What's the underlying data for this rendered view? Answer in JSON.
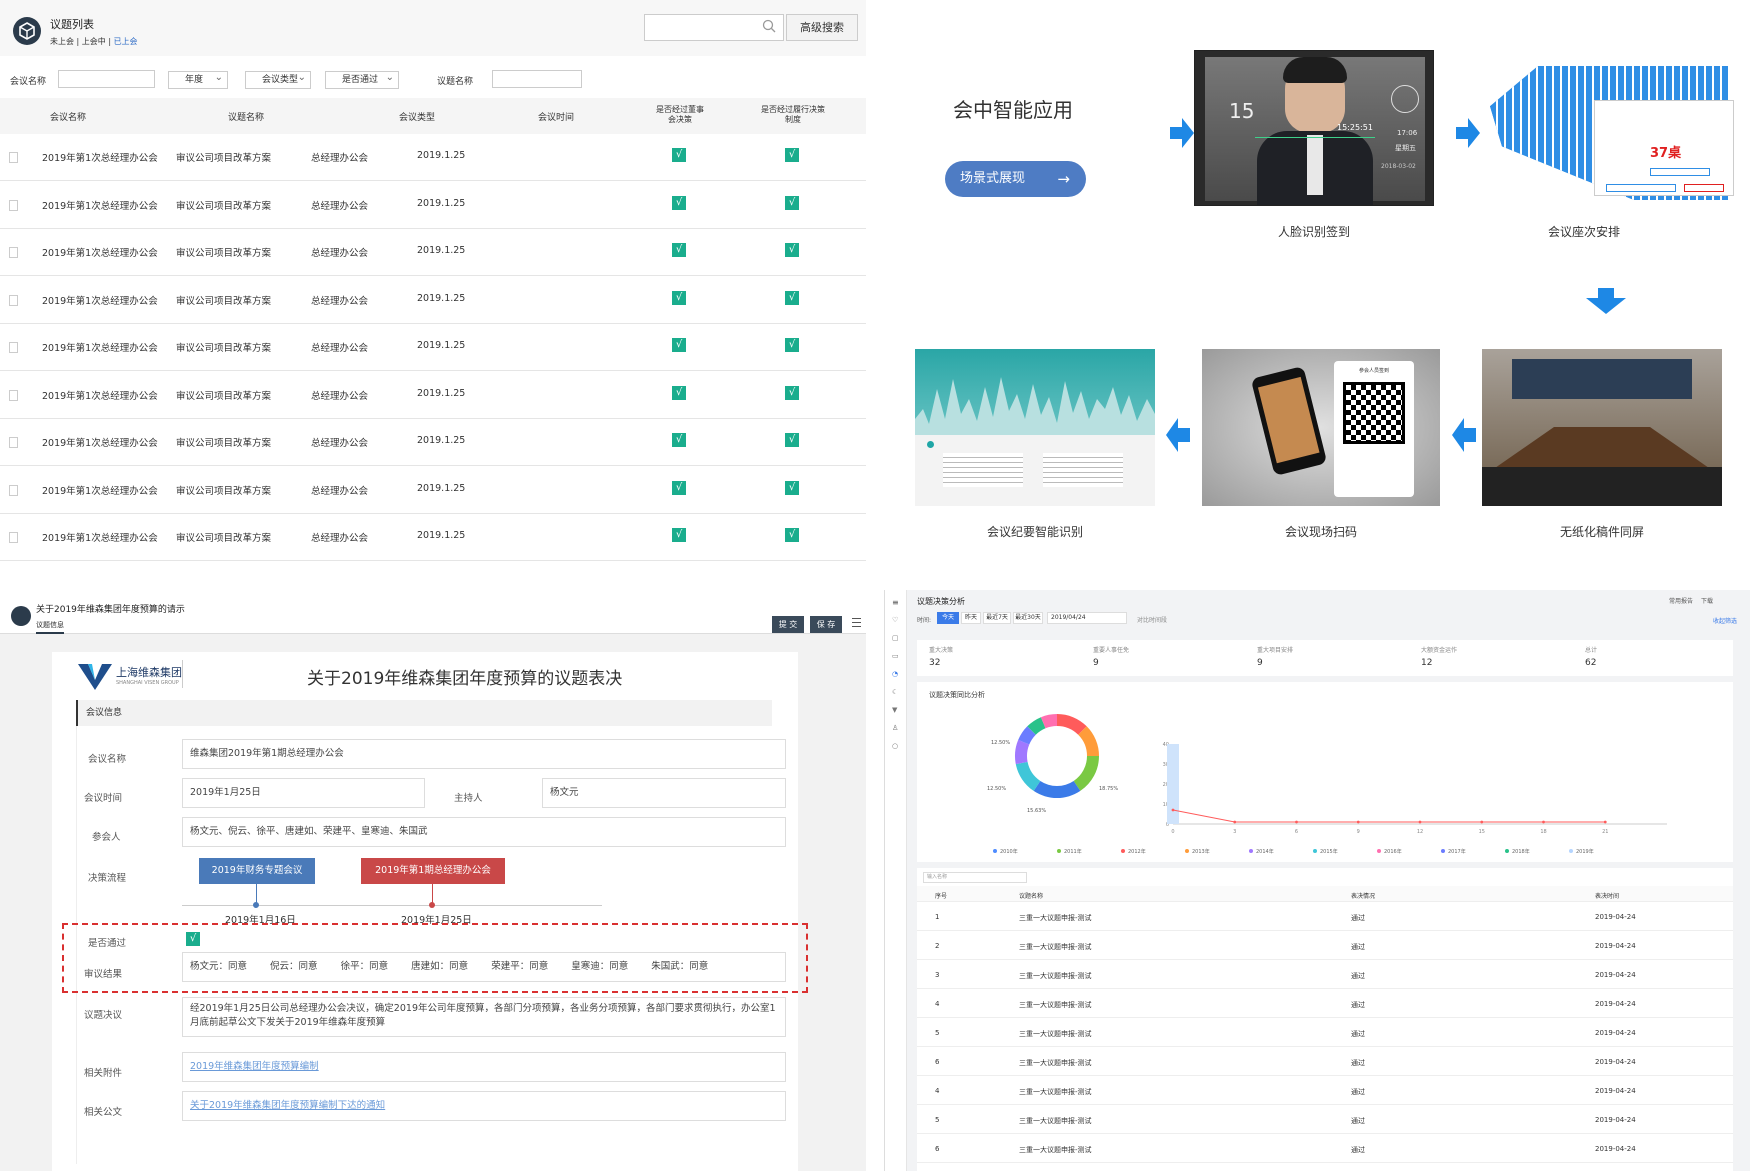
{
  "q1": {
    "title": "议题列表",
    "status_tabs": [
      "未上会",
      "上会中",
      "已上会"
    ],
    "search_button": "高级搜索",
    "filters": {
      "meeting_name_label": "会议名称",
      "year": "年度",
      "meeting_type": "会议类型",
      "passed": "是否通过",
      "topic_name_label": "议题名称"
    },
    "columns": [
      "会议名称",
      "议题名称",
      "会议类型",
      "会议时间",
      "是否经过董事会决策",
      "是否经过履行决策制度"
    ],
    "rows": [
      {
        "meeting": "2019年第1次总经理办公会",
        "topic": "审议公司项目改革方案",
        "type": "总经理办公会",
        "date": "2019.1.25"
      },
      {
        "meeting": "2019年第1次总经理办公会",
        "topic": "审议公司项目改革方案",
        "type": "总经理办公会",
        "date": "2019.1.25"
      },
      {
        "meeting": "2019年第1次总经理办公会",
        "topic": "审议公司项目改革方案",
        "type": "总经理办公会",
        "date": "2019.1.25"
      },
      {
        "meeting": "2019年第1次总经理办公会",
        "topic": "审议公司项目改革方案",
        "type": "总经理办公会",
        "date": "2019.1.25"
      },
      {
        "meeting": "2019年第1次总经理办公会",
        "topic": "审议公司项目改革方案",
        "type": "总经理办公会",
        "date": "2019.1.25"
      },
      {
        "meeting": "2019年第1次总经理办公会",
        "topic": "审议公司项目改革方案",
        "type": "总经理办公会",
        "date": "2019.1.25"
      },
      {
        "meeting": "2019年第1次总经理办公会",
        "topic": "审议公司项目改革方案",
        "type": "总经理办公会",
        "date": "2019.1.25"
      },
      {
        "meeting": "2019年第1次总经理办公会",
        "topic": "审议公司项目改革方案",
        "type": "总经理办公会",
        "date": "2019.1.25"
      },
      {
        "meeting": "2019年第1次总经理办公会",
        "topic": "审议公司项目改革方案",
        "type": "总经理办公会",
        "date": "2019.1.25"
      }
    ],
    "check": "√"
  },
  "q2": {
    "heading": "会中智能应用",
    "scene_button": "场景式展现",
    "captions": {
      "face": "人脸识别签到",
      "seat": "会议座次安排",
      "paperless": "无纸化稿件同屏",
      "scan": "会议现场扫码",
      "minutes": "会议纪要智能识别"
    },
    "face_time": "15:25:51",
    "face_date": "2018-03-02",
    "face_big": "15",
    "face_clock": "17:06",
    "face_weekday": "星期五",
    "seat_number": "37桌",
    "qr_title": "参会人员签到"
  },
  "q3": {
    "title": "关于2019年维森集团年度预算的请示",
    "tab": "议题信息",
    "submit": "提 交",
    "save": "保 存",
    "company": "上海维森集团",
    "company_en": "SHANGHAI VISEN GROUP",
    "doc_title": "关于2019年维森集团年度预算的议题表决",
    "section": "会议信息",
    "fields": {
      "meeting_name_label": "会议名称",
      "meeting_name": "维森集团2019年第1期总经理办公会",
      "time_label": "会议时间",
      "time": "2019年1月25日",
      "host_label": "主持人",
      "host": "杨文元",
      "attendees_label": "参会人",
      "attendees": "杨文元、倪云、徐平、唐建如、荣建平、皇寒迪、朱国武",
      "process_label": "决策流程",
      "step1": "2019年财务专题会议",
      "step1_date": "2019年1月16日",
      "step2": "2019年第1期总经理办公会",
      "step2_date": "2019年1月25日",
      "passed_label": "是否通过",
      "passed": "√",
      "result_label": "审议结果",
      "results": [
        "杨文元：同意",
        "倪云：同意",
        "徐平：同意",
        "唐建如：同意",
        "荣建平：同意",
        "皇寒迪：同意",
        "朱国武：同意"
      ],
      "resolution_label": "议题决议",
      "resolution": "经2019年1月25日公司总经理办公会决议，确定2019年公司年度预算，各部门分项预算，各业务分项预算，各部门要求贯彻执行，办公室1月底前起草公文下发关于2019年维森年度预算",
      "attach_label": "相关附件",
      "attach": "2019年维森集团年度预算编制",
      "doc_label": "相关公文",
      "doc": "关于2019年维森集团年度预算编制下达的通知"
    }
  },
  "q4": {
    "title": "议题决策分析",
    "top_right": [
      "常用报告",
      "下载"
    ],
    "time_label": "时间:",
    "time_tabs": [
      "今天",
      "昨天",
      "最近7天",
      "最近30天"
    ],
    "date_value": "2019/04/24",
    "compare": "对比时间段",
    "collapse": "收起筛选",
    "stats": [
      {
        "label": "重大决策",
        "value": "32"
      },
      {
        "label": "重要人事任免",
        "value": "9"
      },
      {
        "label": "重大项目安排",
        "value": "9"
      },
      {
        "label": "大额资金运作",
        "value": "12"
      },
      {
        "label": "总计",
        "value": "62"
      }
    ],
    "chart_title": "议题决策同比分析",
    "donut_labels": [
      "12.50%",
      "12.50%",
      "15.63%",
      "18.75%"
    ],
    "legend": [
      "2010年",
      "2011年",
      "2012年",
      "2013年",
      "2014年",
      "2015年",
      "2016年",
      "2017年",
      "2018年",
      "2019年"
    ],
    "legend_colors": [
      "#4e8cff",
      "#7ac943",
      "#ff5b5b",
      "#ff9c3a",
      "#a078ff",
      "#3fc6d8",
      "#ff6fb0",
      "#6b7cff",
      "#29c28a",
      "#b5d5ff"
    ],
    "search_placeholder": "输入名称",
    "table_headers": [
      "序号",
      "议题名称",
      "表决情况",
      "表决时间"
    ],
    "table_rows": [
      {
        "no": "1",
        "name": "三重一大议题申报-测试",
        "result": "通过",
        "date": "2019-04-24"
      },
      {
        "no": "2",
        "name": "三重一大议题申报-测试",
        "result": "通过",
        "date": "2019-04-24"
      },
      {
        "no": "3",
        "name": "三重一大议题申报-测试",
        "result": "通过",
        "date": "2019-04-24"
      },
      {
        "no": "4",
        "name": "三重一大议题申报-测试",
        "result": "通过",
        "date": "2019-04-24"
      },
      {
        "no": "5",
        "name": "三重一大议题申报-测试",
        "result": "通过",
        "date": "2019-04-24"
      },
      {
        "no": "6",
        "name": "三重一大议题申报-测试",
        "result": "通过",
        "date": "2019-04-24"
      },
      {
        "no": "4",
        "name": "三重一大议题申报-测试",
        "result": "通过",
        "date": "2019-04-24"
      },
      {
        "no": "5",
        "name": "三重一大议题申报-测试",
        "result": "通过",
        "date": "2019-04-24"
      },
      {
        "no": "6",
        "name": "三重一大议题申报-测试",
        "result": "通过",
        "date": "2019-04-24"
      }
    ]
  },
  "chart_data": {
    "type": "line",
    "title": "议题决策同比分析",
    "x": [
      0,
      3,
      6,
      9,
      12,
      15,
      18,
      21
    ],
    "ylim": [
      0,
      40
    ],
    "yticks": [
      0,
      10,
      20,
      30,
      40
    ],
    "bar": {
      "x": 0,
      "value": 40
    },
    "series": [
      {
        "values": [
          7,
          1,
          1,
          1,
          1,
          1,
          1,
          1
        ]
      }
    ],
    "donut": [
      {
        "label": "12.50%",
        "value": 12.5
      },
      {
        "label": "12.50%",
        "value": 12.5
      },
      {
        "label": "15.63%",
        "value": 15.63
      },
      {
        "label": "18.75%",
        "value": 18.75
      },
      {
        "value": 12.5
      },
      {
        "value": 9.37
      },
      {
        "value": 6.25
      },
      {
        "value": 6.25
      },
      {
        "value": 6.25
      }
    ]
  }
}
